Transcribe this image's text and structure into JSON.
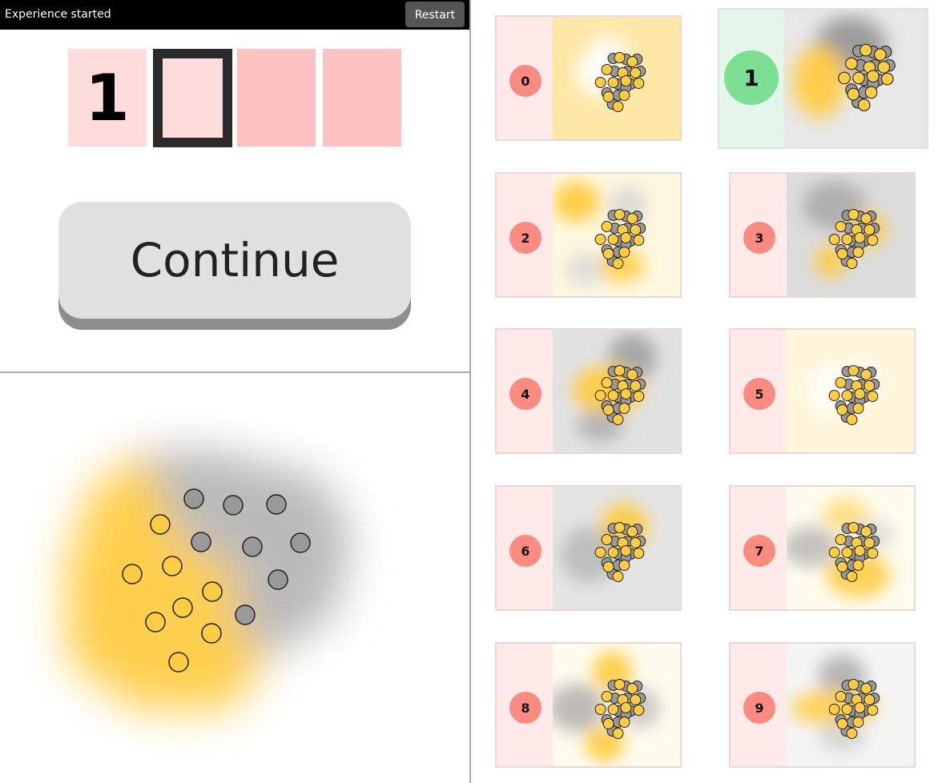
{
  "header": {
    "status": "Experience started",
    "restart_label": "Restart"
  },
  "code_slots": [
    "1",
    "",
    "",
    ""
  ],
  "continue_label": "Continue",
  "colors": {
    "yellow": "#ffcc44",
    "gray": "#999999",
    "selected_green": "#7ddf94",
    "badge_red": "#fb8a80"
  },
  "cards": [
    {
      "label": "0",
      "selected": false
    },
    {
      "label": "1",
      "selected": true
    },
    {
      "label": "2",
      "selected": false
    },
    {
      "label": "3",
      "selected": false
    },
    {
      "label": "4",
      "selected": false
    },
    {
      "label": "5",
      "selected": false
    },
    {
      "label": "6",
      "selected": false
    },
    {
      "label": "7",
      "selected": false
    },
    {
      "label": "8",
      "selected": false
    },
    {
      "label": "9",
      "selected": false
    }
  ]
}
